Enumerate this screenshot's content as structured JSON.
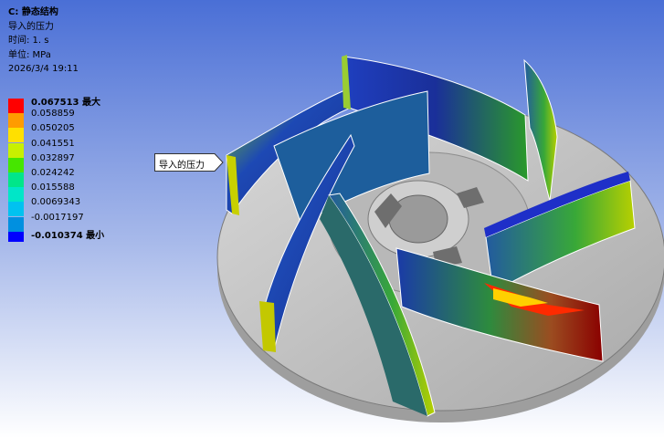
{
  "info": {
    "title": "C: 静态结构",
    "result_name": "导入的压力",
    "time": "时间: 1. s",
    "unit": "单位: MPa",
    "datetime": "2026/3/4 19:11"
  },
  "legend": {
    "entries": [
      {
        "value": "0.067513 最大",
        "color": "#ff0000",
        "bold": true
      },
      {
        "value": "0.058859",
        "color": "#ff9c00",
        "bold": false
      },
      {
        "value": "0.050205",
        "color": "#ffe000",
        "bold": false
      },
      {
        "value": "0.041551",
        "color": "#c8f000",
        "bold": false
      },
      {
        "value": "0.032897",
        "color": "#46e600",
        "bold": false
      },
      {
        "value": "0.024242",
        "color": "#00e68a",
        "bold": false
      },
      {
        "value": "0.015588",
        "color": "#00e6c8",
        "bold": false
      },
      {
        "value": "0.0069343",
        "color": "#00c2f0",
        "bold": false
      },
      {
        "value": "-0.0017197",
        "color": "#0090e0",
        "bold": false
      },
      {
        "value": "-0.010374 最小",
        "color": "#0000ff",
        "bold": true
      }
    ]
  },
  "callout": {
    "label": "导入的压力"
  },
  "colors": {
    "background_top": "#4a6fd6",
    "background_bottom": "#ffffff",
    "hub": "#c7c7c7"
  }
}
